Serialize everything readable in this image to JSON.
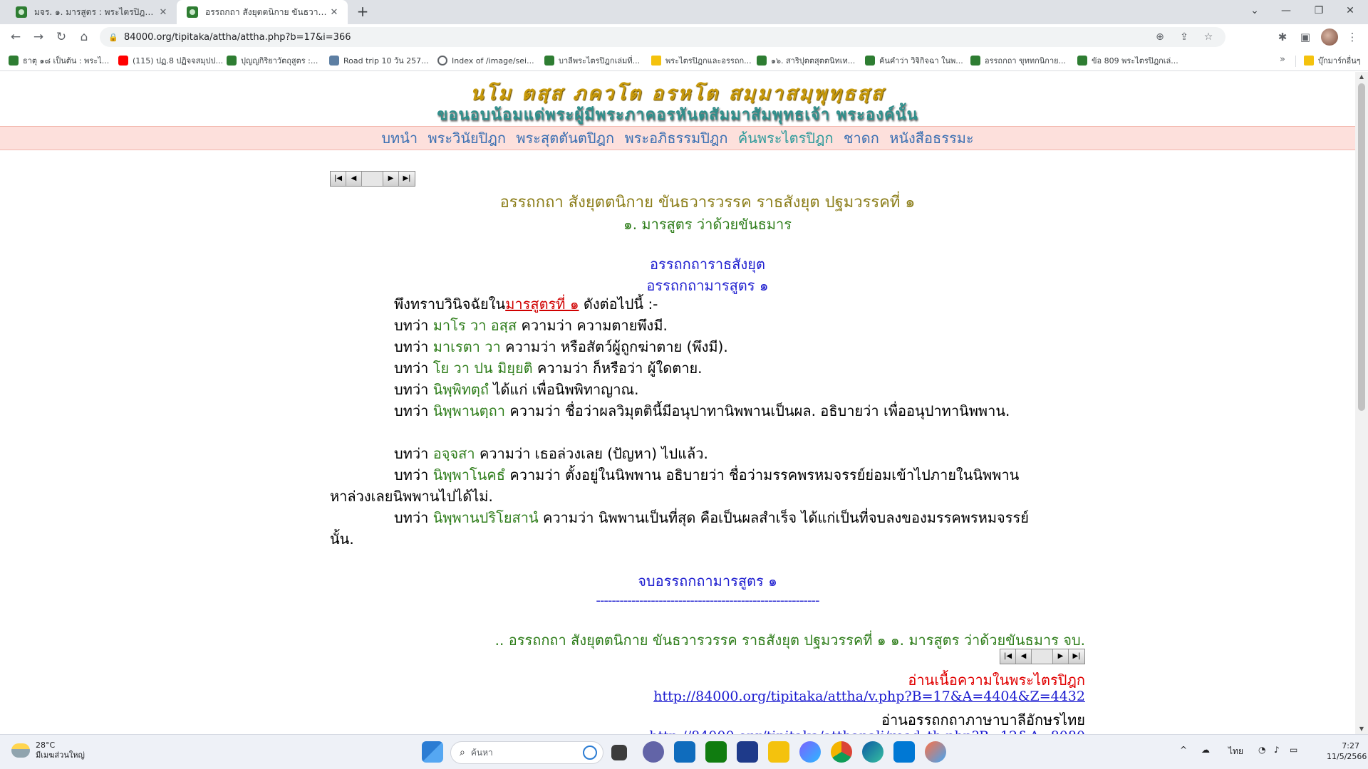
{
  "browser": {
    "tabs": [
      {
        "title": "มจร. ๑. มารสูตร : พระไตรปิฎกเล่มที่ ๑๗",
        "active": false
      },
      {
        "title": "อรรถกถา สังยุตตนิกาย ขันธวารวรรค ราธสังยุต",
        "active": true
      }
    ],
    "new_tab": "+",
    "url": "84000.org/tipitaka/attha/attha.php?b=17&i=366",
    "window": {
      "minimize": "—",
      "restore": "❐",
      "close": "✕",
      "tablist": "⌄"
    },
    "bookmarks": [
      {
        "label": "ธาตุ ๑๘ เป็นต้น : พระไ...",
        "icon": "leaf-icon"
      },
      {
        "label": "(115) ปฏ.8 ปฏิจจสมุปป...",
        "icon": "youtube-icon"
      },
      {
        "label": "ปุญญกิริยาวัตถุสูตร :...",
        "icon": "leaf-icon"
      },
      {
        "label": "Road trip 10 วัน 257...",
        "icon": "image-icon"
      },
      {
        "label": "Index of /image/sei...",
        "icon": "globe-icon"
      },
      {
        "label": "บาลีพระไตรปิฎกเล่มที่...",
        "icon": "leaf-icon"
      },
      {
        "label": "พระไตรปิฎกและอรรถก...",
        "icon": "folder-icon"
      },
      {
        "label": "๑๖. สาริปุตตสุตตนิทเท...",
        "icon": "leaf-icon"
      },
      {
        "label": "ค้นคำว่า วิจิกิจฉา ในพ...",
        "icon": "leaf-icon"
      },
      {
        "label": "อรรถกถา ขุททกนิกาย...",
        "icon": "leaf-icon"
      },
      {
        "label": "ข้อ 809 พระไตรปิฎกเล่...",
        "icon": "leaf-icon"
      }
    ],
    "bookmarks_more": "»",
    "bookmarks_folder": "บุ๊กมาร์กอื่นๆ"
  },
  "page": {
    "banner_pali": "นโม ตสฺส ภควโต อรหโต สมฺมาสมฺพุทฺธสฺส",
    "banner_thai": "ขอนอบน้อมแด่พระผู้มีพระภาคอรหันตสัมมาสัมพุทธเจ้า  พระองค์นั้น",
    "menu": [
      "บทนำ",
      "พระวินัยปิฎก",
      "พระสุตตันตปิฎก",
      "พระอภิธรรมปิฎก",
      "ค้นพระไตรปิฎก",
      "ชาดก",
      "หนังสือธรรมะ"
    ],
    "pager": {
      "first": "|◀",
      "prev": "◀",
      "next": "▶",
      "last": "▶|"
    },
    "title": "อรรถกถา สังยุตตนิกาย ขันธวารวรรค ราธสังยุต ปฐมวรรคที่ ๑",
    "subtitle": "๑. มารสูตร ว่าด้วยขันธมาร",
    "heading1": "อรรถกถาราธสังยุต",
    "heading2": "อรรถกถามารสูตร ๑",
    "para1": {
      "pre": "พึงทราบวินิจฉัยใน",
      "link": "มารสูตรที่ ๑",
      "post": " ดังต่อไปนี้ :-"
    },
    "lines": [
      {
        "lead": "บทว่า ",
        "pali": "มาโร วา อสฺส",
        "rest": " ความว่า ความตายพึงมี."
      },
      {
        "lead": "บทว่า ",
        "pali": "มาเรตา วา",
        "rest": " ความว่า หรือสัตว์ผู้ถูกฆ่าตาย (พึงมี)."
      },
      {
        "lead": "บทว่า ",
        "pali": "โย วา ปน มิยฺยติ",
        "rest": " ความว่า ก็หรือว่า ผู้ใดตาย."
      },
      {
        "lead": "บทว่า ",
        "pali": "นิพฺพิทตฺถํ",
        "rest": " ได้แก่ เพื่อนิพพิทาญาณ."
      },
      {
        "lead": "บทว่า ",
        "pali": "นิพฺพานตฺถา",
        "rest": " ความว่า ชื่อว่าผลวิมุตตินี้มีอนุปาทานิพพานเป็นผล. อธิบายว่า เพื่ออนุปาทานิพพาน."
      },
      {
        "lead": "บทว่า ",
        "pali": "อจฺจสา",
        "rest": " ความว่า เธอล่วงเลย (ปัญหา) ไปแล้ว."
      },
      {
        "lead": "บทว่า ",
        "pali": "นิพฺพาโนคธํ",
        "rest": " ความว่า ตั้งอยู่ในนิพพาน อธิบายว่า ชื่อว่ามรรคพรหมจรรย์ย่อมเข้าไปภายในนิพพาน หาล่วงเลยนิพพานไปได้ไม่."
      },
      {
        "lead": "บทว่า ",
        "pali": "นิพฺพานปริโยสานํ",
        "rest": " ความว่า นิพพานเป็นที่สุด คือเป็นผลสำเร็จ ได้แก่เป็นที่จบลงของมรรคพรหมจรรย์นั้น."
      }
    ],
    "end_heading": "จบอรรถกถามารสูตร ๑",
    "dashes": "---------------------------------------------------------",
    "end_line": ".. อรรถกถา สังยุตตนิกาย ขันธวารวรรค ราธสังยุต ปฐมวรรคที่ ๑ ๑. มารสูตร ว่าด้วยขันธมาร จบ.",
    "read_tipitaka": "อ่านเนื้อความในพระไตรปิฎก",
    "read_tipitaka_url": "http://84000.org/tipitaka/attha/v.php?B=17&A=4404&Z=4432",
    "read_pali": "อ่านอรรถกถาภาษาบาลีอักษรไทย",
    "read_pali_url": "http://84000.org/tipitaka/atthapali/read_th.php?B=12&A=8080"
  },
  "taskbar": {
    "weather_temp": "28°C",
    "weather_desc": "มีเมฆส่วนใหญ่",
    "search_placeholder": "ค้นหา",
    "lang": "ไทย",
    "time": "7:27",
    "date": "11/5/2566",
    "tray_chevron": "^"
  }
}
